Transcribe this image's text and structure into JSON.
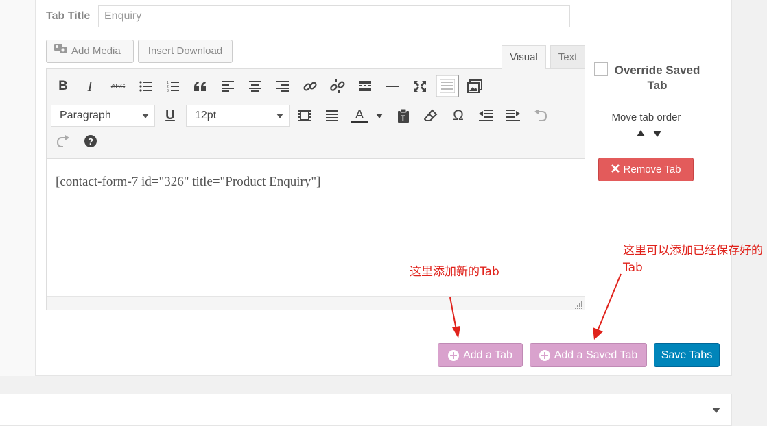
{
  "tab_title": {
    "label": "Tab Title",
    "value": "Enquiry"
  },
  "media_buttons": {
    "add_media": "Add Media",
    "insert_download": "Insert Download"
  },
  "editor_tabs": {
    "visual": "Visual",
    "text": "Text",
    "active": "Visual"
  },
  "toolbar": {
    "row1": [
      "bold-icon",
      "italic-icon",
      "strikethrough-icon",
      "bullet-list-icon",
      "numbered-list-icon",
      "blockquote-icon",
      "align-left-icon",
      "align-center-icon",
      "align-right-icon",
      "insert-link-icon",
      "remove-link-icon",
      "read-more-icon",
      "horizontal-line-icon",
      "fullscreen-icon",
      "toolbar-toggle-icon",
      "gallery-icon"
    ],
    "row2": [
      "underline-icon",
      "justify-icon",
      "text-color-icon",
      "paste-text-icon",
      "clear-formatting-icon",
      "special-character-icon",
      "outdent-icon",
      "indent-icon",
      "undo-icon"
    ],
    "row3": [
      "redo-icon",
      "help-icon"
    ],
    "format_select": "Paragraph",
    "size_select": "12pt",
    "bold_glyph": "B",
    "italic_glyph": "I",
    "strike_glyph": "ABC",
    "underline_glyph": "U",
    "text_color_glyph": "A",
    "omega_glyph": "Ω"
  },
  "editor_content": "[contact-form-7 id=\"326\" title=\"Product Enquiry\"]",
  "side": {
    "override_label": "Override Saved Tab",
    "move_order": "Move tab order",
    "remove_tab": "Remove Tab"
  },
  "actions": {
    "add_tab": "Add a Tab",
    "add_saved_tab": "Add a Saved Tab",
    "save_tabs": "Save Tabs"
  },
  "annotations": {
    "add_new": "这里添加新的Tab",
    "add_saved": "这里可以添加已经保存好的Tab"
  },
  "colors": {
    "purple_button": "#d9a2cd",
    "save_button": "#0085ba",
    "remove_button": "#e35b5b",
    "annotation": "#e0231c"
  }
}
